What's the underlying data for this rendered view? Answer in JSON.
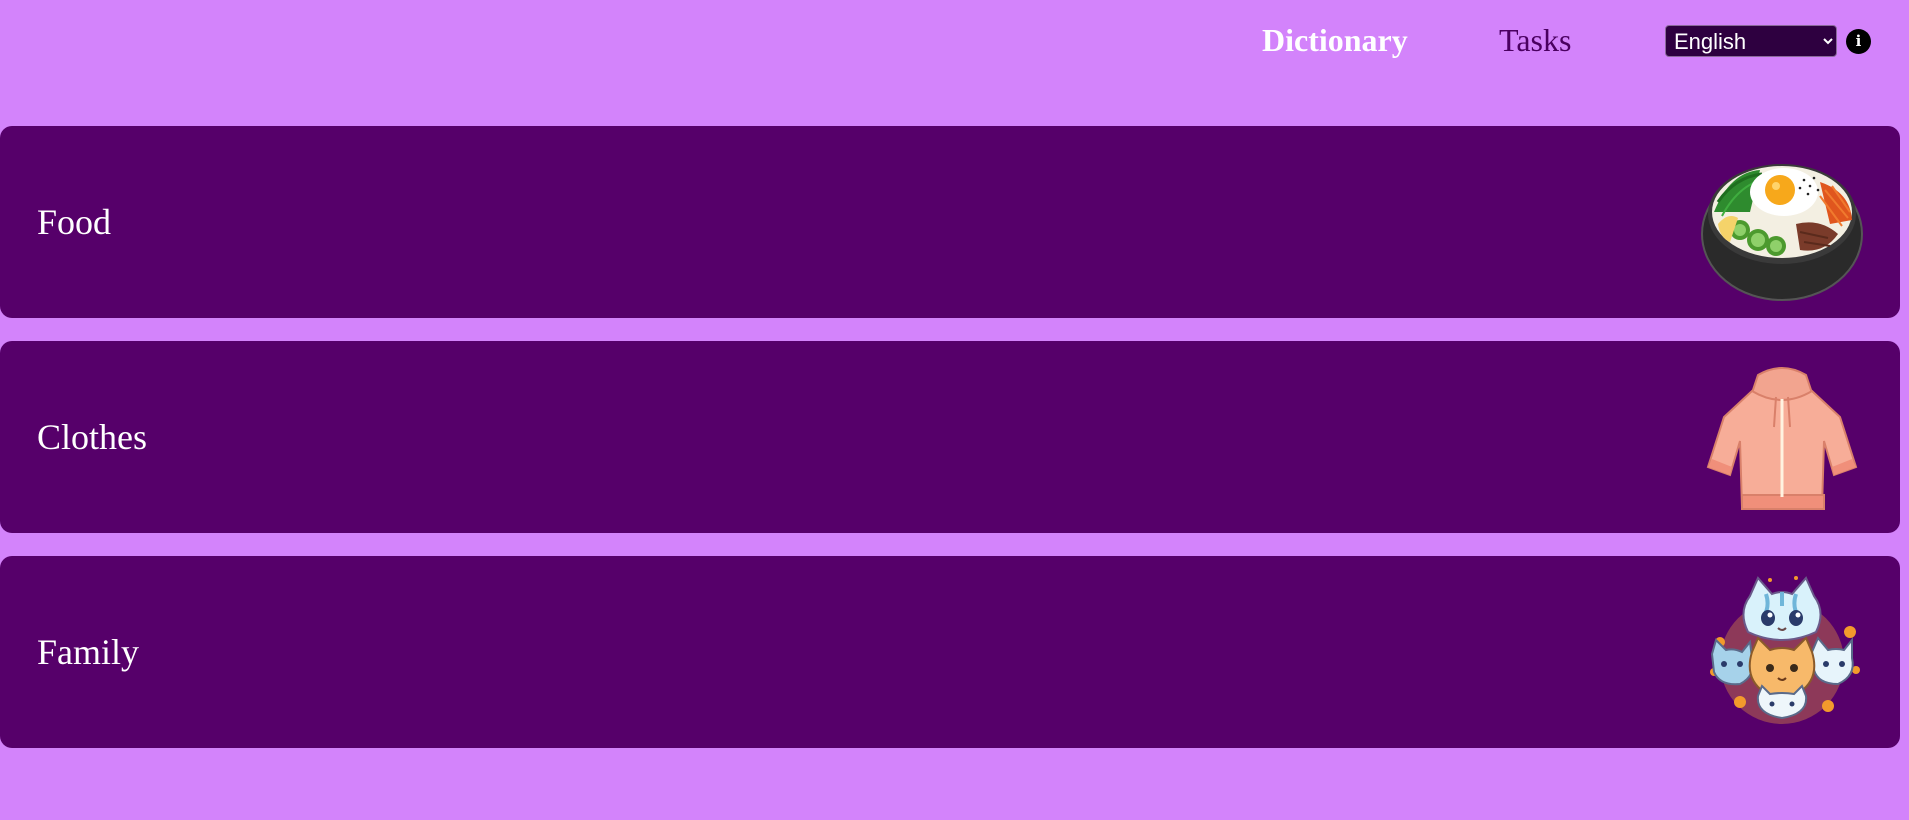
{
  "nav": {
    "dictionary_label": "Dictionary",
    "tasks_label": "Tasks",
    "language": {
      "selected": "English"
    },
    "info_icon_glyph": "i"
  },
  "categories": [
    {
      "label": "Food",
      "icon": "bibimbap-bowl-icon"
    },
    {
      "label": "Clothes",
      "icon": "pink-hoodie-icon"
    },
    {
      "label": "Family",
      "icon": "cat-family-icon"
    }
  ],
  "colors": {
    "background": "#d383fb",
    "card": "#56006a",
    "nav_active": "#ffffff",
    "nav_inactive": "#4a0060"
  }
}
